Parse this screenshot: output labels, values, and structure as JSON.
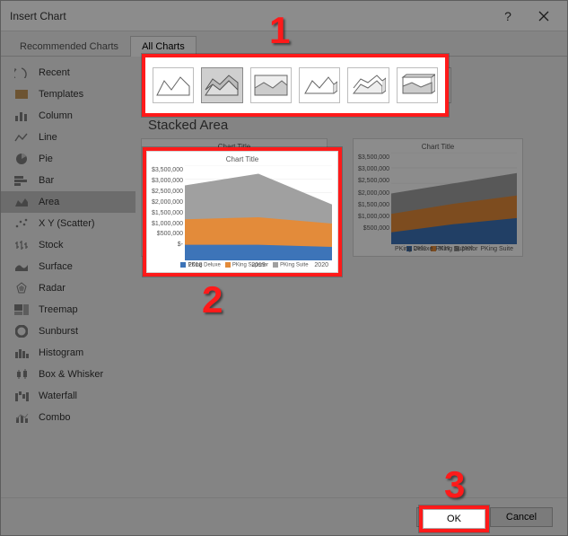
{
  "dialog": {
    "title": "Insert Chart"
  },
  "tabs": {
    "recommended": "Recommended Charts",
    "all": "All Charts"
  },
  "sidebar": {
    "items": [
      "Recent",
      "Templates",
      "Column",
      "Line",
      "Pie",
      "Bar",
      "Area",
      "X Y (Scatter)",
      "Stock",
      "Surface",
      "Radar",
      "Treemap",
      "Sunburst",
      "Histogram",
      "Box & Whisker",
      "Waterfall",
      "Combo"
    ],
    "active_index": 6
  },
  "subtype_title": "Stacked Area",
  "subtypes": {
    "selected_index": 1,
    "count": 6
  },
  "preview": {
    "title": "Chart Title",
    "y_ticks": [
      "$3,500,000",
      "$3,000,000",
      "$2,500,000",
      "$2,000,000",
      "$1,500,000",
      "$1,000,000",
      "$500,000",
      "$-"
    ],
    "x_ticks": [
      "2018",
      "2019",
      "2020"
    ],
    "legend": [
      "PKing Deluxe",
      "PKing Superior",
      "PKing Suite"
    ],
    "colors": {
      "s1": "#3d74b8",
      "s2": "#e38b3a",
      "s3": "#a0a0a0"
    }
  },
  "preview2": {
    "title": "Chart Title",
    "y_ticks": [
      "$3,500,000",
      "$3,000,000",
      "$2,500,000",
      "$2,000,000",
      "$1,500,000",
      "$1,000,000",
      "$500,000"
    ],
    "x_ticks": [
      "PKing Deluxe",
      "PKing Superior",
      "PKing Suite"
    ],
    "legend": [
      "2018",
      "2019",
      "2020"
    ]
  },
  "footer": {
    "ok": "OK",
    "cancel": "Cancel"
  },
  "annotations": {
    "n1": "1",
    "n2": "2",
    "n3": "3"
  },
  "chart_data": {
    "type": "area",
    "subtype": "stacked",
    "title": "Chart Title",
    "xlabel": "",
    "ylabel": "",
    "ylim": [
      0,
      3500000
    ],
    "categories": [
      "2018",
      "2019",
      "2020"
    ],
    "series": [
      {
        "name": "PKing Deluxe",
        "values": [
          600000,
          600000,
          500000
        ],
        "color": "#3d74b8"
      },
      {
        "name": "PKing Superior",
        "values": [
          900000,
          1000000,
          850000
        ],
        "color": "#e38b3a"
      },
      {
        "name": "PKing Suite",
        "values": [
          1250000,
          1600000,
          700000
        ],
        "color": "#a0a0a0"
      }
    ]
  }
}
